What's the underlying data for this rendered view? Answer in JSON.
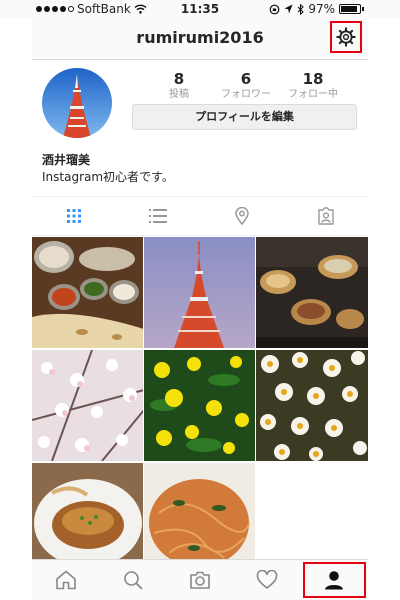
{
  "status": {
    "carrier": "SoftBank",
    "time": "11:35",
    "battery": "97%"
  },
  "header": {
    "username": "rumirumi2016"
  },
  "stats": [
    {
      "value": "8",
      "label": "投稿"
    },
    {
      "value": "6",
      "label": "フォロワー"
    },
    {
      "value": "18",
      "label": "フォロー中"
    }
  ],
  "profile": {
    "edit_label": "プロフィールを編集",
    "name": "酒井瑠美",
    "bio": "Instagram初心者です。"
  },
  "tabs": [
    "grid-icon",
    "list-icon",
    "location-pin-icon",
    "tagged-photos-icon"
  ],
  "photos": [
    "indian-curry-naan",
    "tokyo-tower",
    "okonomiyaki",
    "cherry-blossoms",
    "yellow-flowers",
    "white-daisies",
    "hamburg-steak",
    "pasta"
  ],
  "bottom_nav": [
    "home-icon",
    "search-icon",
    "camera-icon",
    "heart-icon",
    "profile-icon"
  ],
  "colors": {
    "highlight": "#e60012",
    "accent": "#3897f0",
    "text": "#262626",
    "muted": "#999999"
  }
}
